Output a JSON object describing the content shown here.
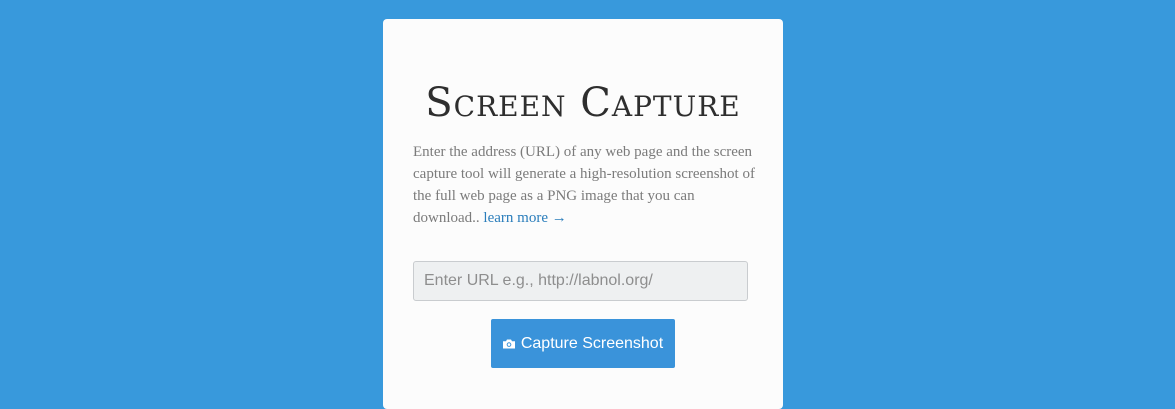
{
  "card": {
    "title": "Screen Capture",
    "description": "Enter the address (URL) of any web page and the screen capture tool will generate a high-resolution screenshot of the full web page as a PNG image that you can download..",
    "learn_more_label": "learn more →",
    "url_input": {
      "placeholder": "Enter URL e.g., http://labnol.org/",
      "value": ""
    },
    "capture_button": {
      "label": "Capture Screenshot",
      "icon": "camera-icon"
    }
  },
  "colors": {
    "background": "#3899dc",
    "card": "#fcfcfc",
    "button": "#3a93da",
    "link": "#2a7dbb"
  }
}
